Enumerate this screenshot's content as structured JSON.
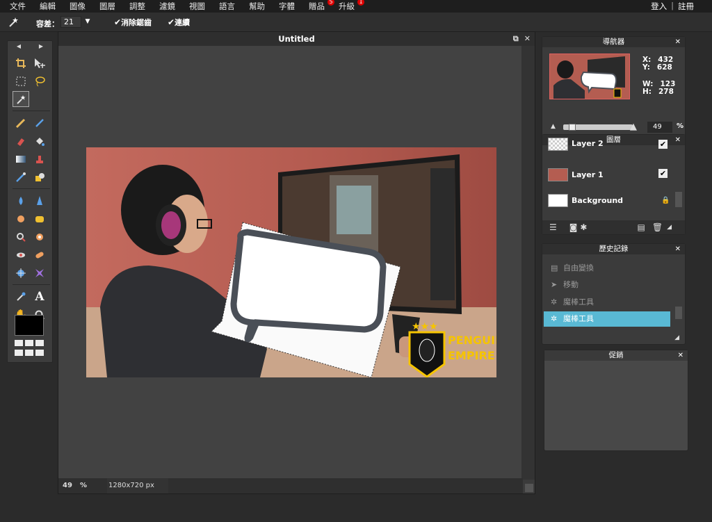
{
  "menu": {
    "items": [
      "文件",
      "編輯",
      "圖像",
      "圖層",
      "調整",
      "濾鏡",
      "視圖",
      "語言",
      "幫助",
      "字體",
      "贈品",
      "升級"
    ],
    "gift_badge": "5",
    "upgrade_badge": "1",
    "login": "登入",
    "separator": "|",
    "register": "註冊"
  },
  "tool_options": {
    "tolerance_label": "容差：",
    "tolerance_value": "21",
    "antialias_label": "消除鋸齒",
    "contiguous_label": "連續"
  },
  "document": {
    "title": "Untitled",
    "zoom": "49",
    "zoom_unit": "%",
    "dimensions": "1280x720 px"
  },
  "navigator": {
    "title": "導航器",
    "x_label": "X:",
    "x_value": "432",
    "y_label": "Y:",
    "y_value": "628",
    "w_label": "W:",
    "w_value": "123",
    "h_label": "H:",
    "h_value": "278",
    "zoom_value": "49",
    "zoom_unit": "%"
  },
  "layers": {
    "title": "圖層",
    "items": [
      {
        "name": "Layer 2",
        "visible": "✔"
      },
      {
        "name": "Layer 1",
        "visible": "✔"
      },
      {
        "name": "Background",
        "visible": ""
      }
    ]
  },
  "history": {
    "title": "歷史記錄",
    "items": [
      "自由變換",
      "移動",
      "魔棒工具",
      "魔棒工具"
    ]
  },
  "promo": {
    "title": "促銷"
  },
  "image_text": {
    "brand_line1": "PENGUINS",
    "brand_line2": "EMPIRE"
  },
  "colors": {
    "accent": "#59b9d4",
    "background": "#2b2b2b",
    "panel": "#3b3b3b",
    "image_wall": "#b96256",
    "brand_yellow": "#f5c400"
  }
}
